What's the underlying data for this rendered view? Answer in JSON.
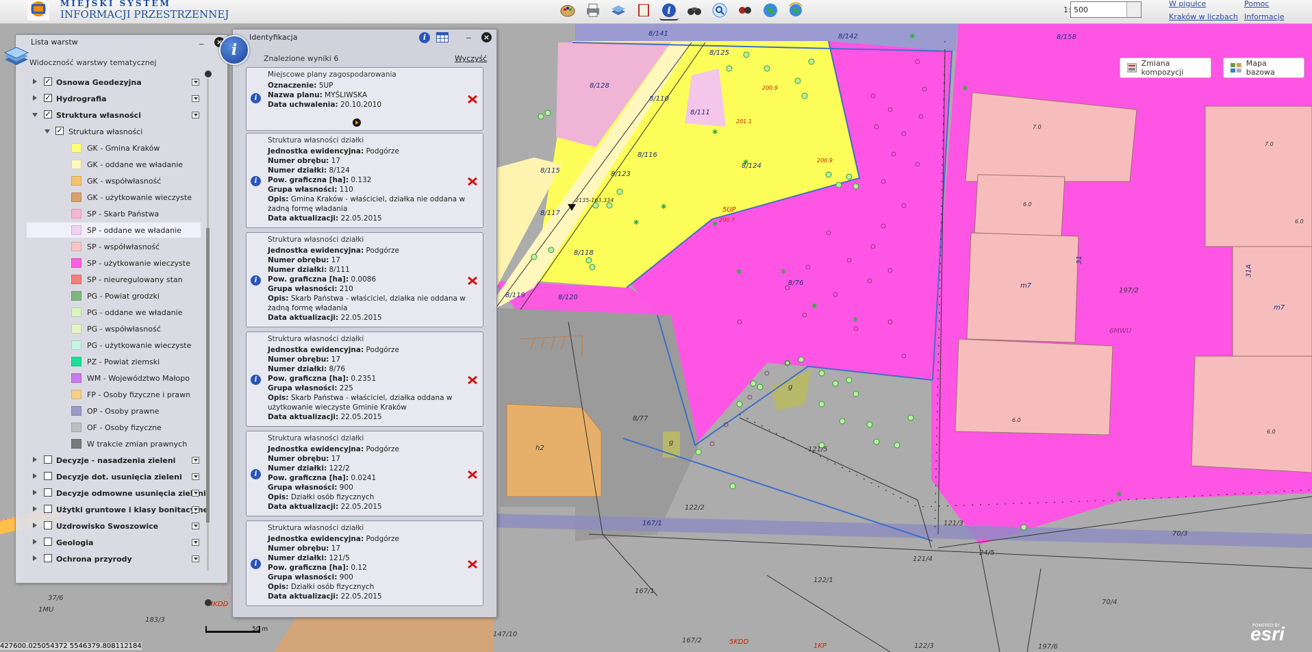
{
  "header": {
    "logo_line1": "MIEJSKI SYSTEM",
    "logo_line2": "INFORMACJI PRZESTRZENNEJ",
    "scale_prefix": "1:",
    "scale_value": "500",
    "links": [
      "W pigułce",
      "Kraków w liczbach",
      "Pomoc",
      "Informacje"
    ]
  },
  "toolbar_icons": [
    "palette-icon",
    "print-icon",
    "layers-icon",
    "book-icon",
    "identify-info-icon",
    "binoculars-icon",
    "search-icon",
    "measure-icon",
    "globe-icon",
    "globe-refresh-icon"
  ],
  "map": {
    "composition_button": "Zmiana kompozycji",
    "basemap_button": "Mapa bazowa",
    "coords": "427600.025054372 5546379.808112184",
    "scalebar_label": "50 m",
    "esri_label": "esri",
    "esri_powered": "POWERED BY",
    "labels": {
      "l8141": "8/141",
      "l8142": "8/142",
      "l8158": "8/158",
      "l8128": "8/128",
      "l8110": "8/110",
      "l8125": "8/125",
      "l8111": "8/111",
      "l8115": "8/115",
      "l8116": "8/116",
      "l8123": "8/123",
      "l8124": "8/124",
      "l5up": "5UP",
      "l8117": "8/117",
      "l8118": "8/118",
      "l8119": "8/119",
      "l8120": "8/120",
      "l876": "8/76",
      "l877": "8/77",
      "l1215": "121/5",
      "l1222": "122/2",
      "l1671": "167/1",
      "l1213": "121/3",
      "l1214": "121/4",
      "l1221": "122/1",
      "l1671b": "167/1",
      "l245": "24/5",
      "l1972": "197/2",
      "l6mwu": "6MWU",
      "lm7a": "m7",
      "lm7b": "m7",
      "l31": "31",
      "l31a": "31A",
      "lh2": "h2",
      "lg1": "g",
      "lg2": "g",
      "l703": "70/3",
      "l704": "70/4",
      "l1mu": "1MU",
      "l4kdd": "4KDD",
      "l5kdd": "5KDD",
      "l1kp": "1KP",
      "l1223": "122/3",
      "l1976": "197/6",
      "l14710": "147/10",
      "l1833": "183/3",
      "l1672": "167/2",
      "l376": "37/6",
      "h1": "7.0",
      "h2": "6.0",
      "h3": "6.0",
      "h4": "7.0",
      "h5": "6.0",
      "h6": "6.0",
      "r1": "200.9",
      "r2": "201.1",
      "r3": "200.7",
      "r4": "200.9",
      "rpt": "2135-163.334"
    }
  },
  "layer_panel": {
    "title": "Lista warstw",
    "visibility_label": "Widoczność warstwy tematycznej",
    "groups_top": [
      {
        "label": "Osnowa Geodezyjna",
        "checked": true
      },
      {
        "label": "Hydrografia",
        "checked": true
      },
      {
        "label": "Struktura własności",
        "checked": true
      }
    ],
    "sublayer": {
      "label": "Struktura własności",
      "checked": true
    },
    "legend": [
      {
        "label": "GK - Gmina Kraków",
        "color": "#ffff7a"
      },
      {
        "label": "GK - oddane we władanie",
        "color": "#fff9c0"
      },
      {
        "label": "GK - współwłasność",
        "color": "#f3c46e"
      },
      {
        "label": "GK - użytkowanie wieczyste",
        "color": "#d9a36e"
      },
      {
        "label": "SP - Skarb Państwa",
        "color": "#f5b8cf"
      },
      {
        "label": "SP - oddane we władanie",
        "color": "#f4d0f4"
      },
      {
        "label": "SP - współwłasność",
        "color": "#f8c4c4"
      },
      {
        "label": "SP - użytkowanie wieczyste",
        "color": "#ff60e0"
      },
      {
        "label": "SP - nieuregulowany stan",
        "color": "#f08080"
      },
      {
        "label": "PG - Powiat grodzki",
        "color": "#7fb87f"
      },
      {
        "label": "PG - oddane we władanie",
        "color": "#d8f5c0"
      },
      {
        "label": "PG - współwłasność",
        "color": "#e6f5c6"
      },
      {
        "label": "PG - użytkowanie wieczyste",
        "color": "#c6f5e6"
      },
      {
        "label": "PZ - Powiat ziemski",
        "color": "#1fe09a"
      },
      {
        "label": "WM - Województwo Małopolskie",
        "color": "#c87af0"
      },
      {
        "label": "FP - Osoby fizyczne i prawne",
        "color": "#f5cf86"
      },
      {
        "label": "OP - Osoby prawne",
        "color": "#9a9ac6"
      },
      {
        "label": "OF - Osoby fizyczne",
        "color": "#bebebe"
      },
      {
        "label": "W trakcie zmian prawnych",
        "color": "#7a7a7a"
      }
    ],
    "groups_bottom": [
      {
        "label": "Decyzje - nasadzenia zieleni",
        "checked": false
      },
      {
        "label": "Decyzje dot. usunięcia zieleni",
        "checked": false
      },
      {
        "label": "Decyzje odmowne usunięcia zieleni",
        "checked": false
      },
      {
        "label": "Użytki gruntowe i klasy bonitacyjne",
        "checked": false
      },
      {
        "label": "Uzdrowisko Swoszowice",
        "checked": false
      },
      {
        "label": "Geologia",
        "checked": false
      },
      {
        "label": "Ochrona przyrody",
        "checked": false
      }
    ]
  },
  "ident_panel": {
    "title": "Identyfikacja",
    "count_label": "Znalezione wyniki 6",
    "clear_label": "Wyczyść",
    "results": [
      {
        "title": "Miejscowe plany zagospodarowania",
        "fields": [
          {
            "k": "Oznaczenie:",
            "v": " 5UP"
          },
          {
            "k": "Nazwa planu:",
            "v": " MYŚLIWSKA"
          },
          {
            "k": "Data uchwalenia:",
            "v": " 20.10.2010"
          }
        ]
      },
      {
        "title": "Struktura własności działki",
        "fields": [
          {
            "k": "Jednostka ewidencyjna:",
            "v": " Podgórze"
          },
          {
            "k": "Numer obrębu:",
            "v": " 17"
          },
          {
            "k": "Numer działki:",
            "v": " 8/124"
          },
          {
            "k": "Pow. graficzna [ha]:",
            "v": " 0.132"
          },
          {
            "k": "Grupa własności:",
            "v": " 110"
          },
          {
            "k": "Opis:",
            "v": " Gmina Kraków - właściciel, działka nie oddana w"
          },
          {
            "k": "",
            "v": "żadną formę władania"
          },
          {
            "k": "Data aktualizacji:",
            "v": " 22.05.2015"
          }
        ]
      },
      {
        "title": "Struktura własności działki",
        "fields": [
          {
            "k": "Jednostka ewidencyjna:",
            "v": " Podgórze"
          },
          {
            "k": "Numer obrębu:",
            "v": " 17"
          },
          {
            "k": "Numer działki:",
            "v": " 8/111"
          },
          {
            "k": "Pow. graficzna [ha]:",
            "v": " 0.0086"
          },
          {
            "k": "Grupa własności:",
            "v": " 210"
          },
          {
            "k": "Opis:",
            "v": " Skarb Państwa - właściciel, działka nie oddana w"
          },
          {
            "k": "",
            "v": "żadną formę władania"
          },
          {
            "k": "Data aktualizacji:",
            "v": " 22.05.2015"
          }
        ]
      },
      {
        "title": "Struktura własności działki",
        "fields": [
          {
            "k": "Jednostka ewidencyjna:",
            "v": " Podgórze"
          },
          {
            "k": "Numer obrębu:",
            "v": " 17"
          },
          {
            "k": "Numer działki:",
            "v": " 8/76"
          },
          {
            "k": "Pow. graficzna [ha]:",
            "v": " 0.2351"
          },
          {
            "k": "Grupa własności:",
            "v": " 225"
          },
          {
            "k": "Opis:",
            "v": " Skarb Państwa - właściciel, działka oddana w"
          },
          {
            "k": "",
            "v": "użytkowanie wieczyste Gminie Kraków"
          },
          {
            "k": "Data aktualizacji:",
            "v": " 22.05.2015"
          }
        ]
      },
      {
        "title": "Struktura własności działki",
        "fields": [
          {
            "k": "Jednostka ewidencyjna:",
            "v": " Podgórze"
          },
          {
            "k": "Numer obrębu:",
            "v": " 17"
          },
          {
            "k": "Numer działki:",
            "v": " 122/2"
          },
          {
            "k": "Pow. graficzna [ha]:",
            "v": " 0.0241"
          },
          {
            "k": "Grupa własności:",
            "v": " 900"
          },
          {
            "k": "Opis:",
            "v": " Działki osób fizycznych"
          },
          {
            "k": "Data aktualizacji:",
            "v": " 22.05.2015"
          }
        ]
      },
      {
        "title": "Struktura własności działki",
        "fields": [
          {
            "k": "Jednostka ewidencyjna:",
            "v": " Podgórze"
          },
          {
            "k": "Numer obrębu:",
            "v": " 17"
          },
          {
            "k": "Numer działki:",
            "v": " 121/5"
          },
          {
            "k": "Pow. graficzna [ha]:",
            "v": " 0.12"
          },
          {
            "k": "Grupa własności:",
            "v": " 900"
          },
          {
            "k": "Opis:",
            "v": " Działki osób fizycznych"
          },
          {
            "k": "Data aktualizacji:",
            "v": " 22.05.2015"
          }
        ]
      }
    ]
  }
}
